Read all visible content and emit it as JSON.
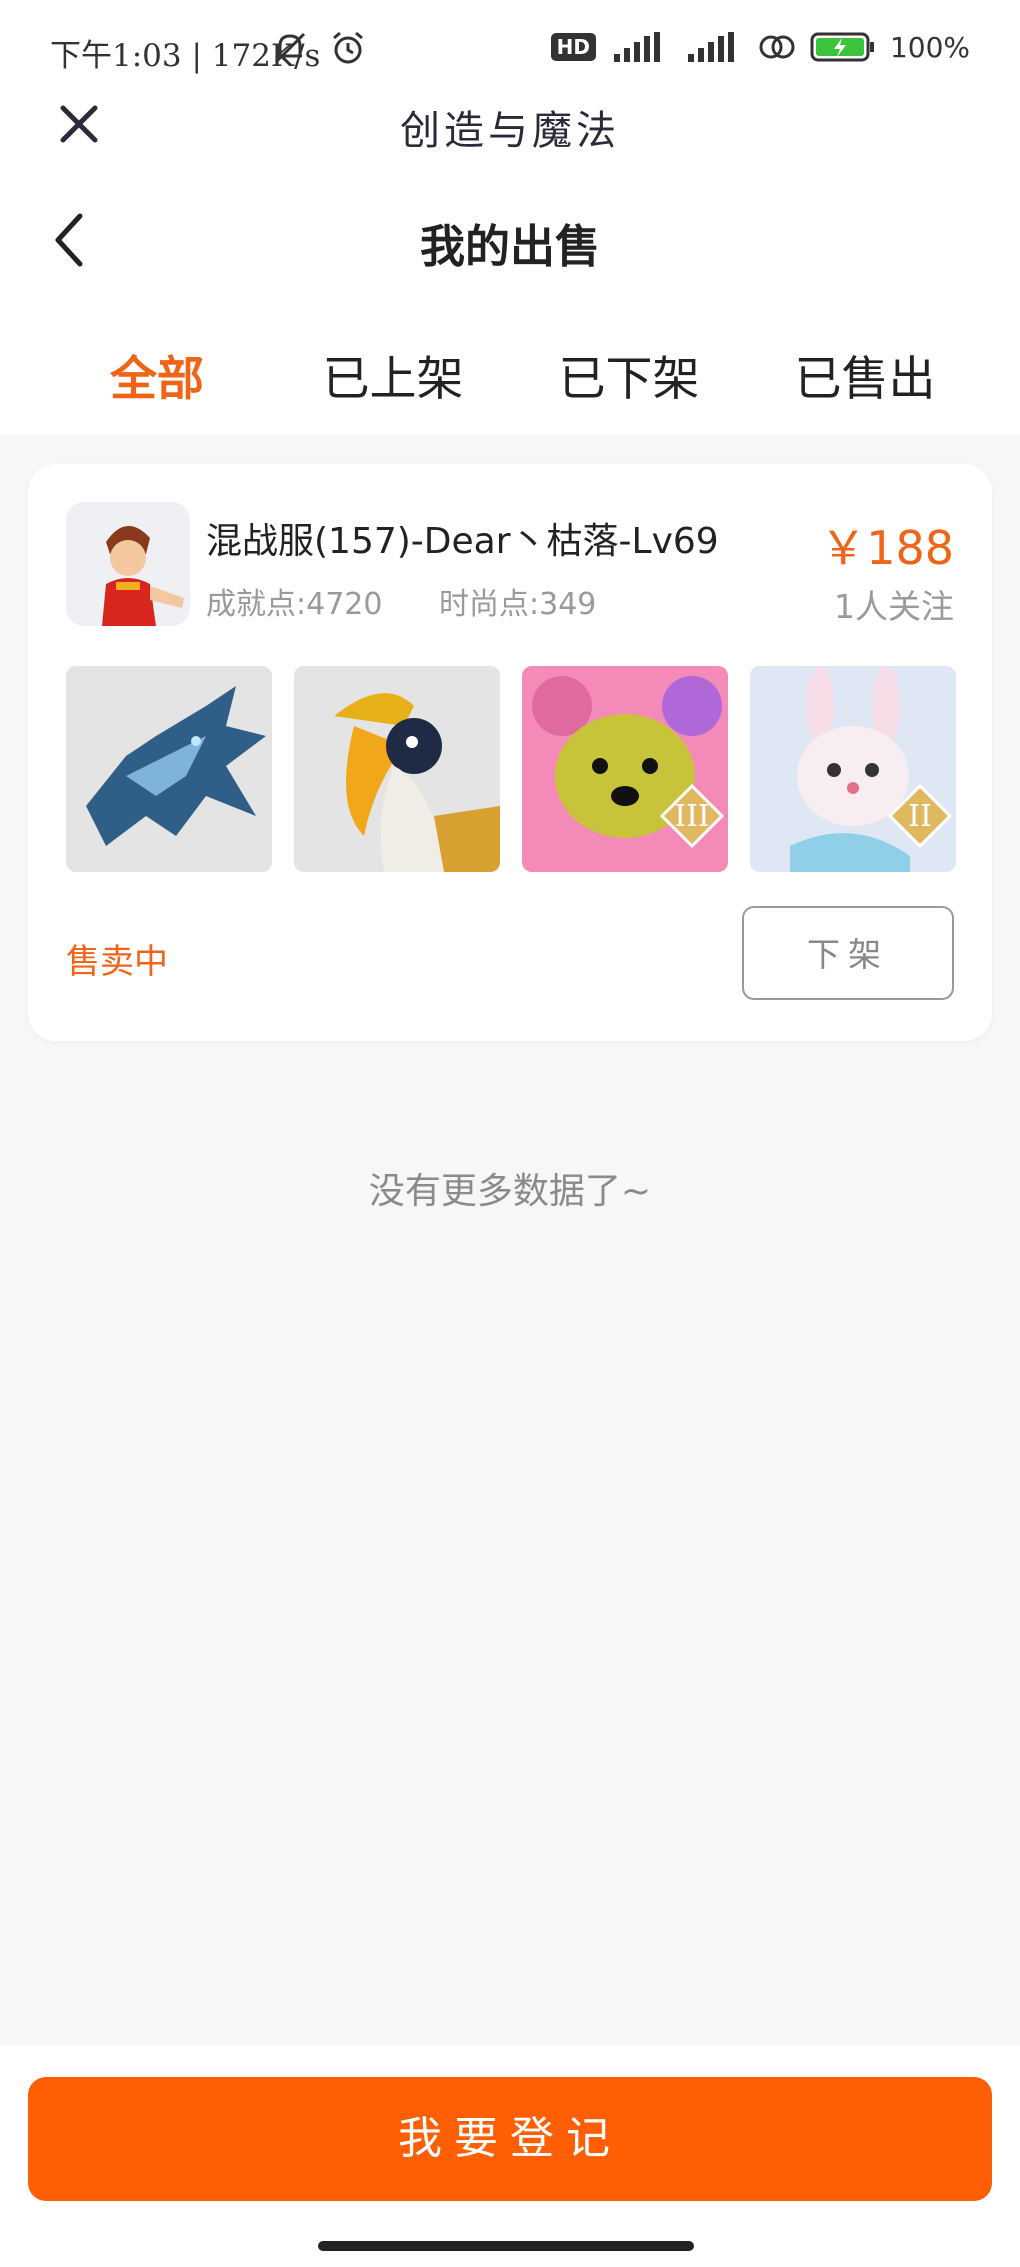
{
  "status_bar": {
    "time": "下午1:03 | 172K/s",
    "hd": "HD",
    "battery": "100%"
  },
  "webview": {
    "app_title": "创造与魔法"
  },
  "header": {
    "title": "我的出售"
  },
  "tabs": [
    {
      "label": "全部",
      "active": true
    },
    {
      "label": "已上架",
      "active": false
    },
    {
      "label": "已下架",
      "active": false
    },
    {
      "label": "已售出",
      "active": false
    }
  ],
  "listing": {
    "title": "混战服(157)-Dear丶枯落-Lv69",
    "achievement": "成就点:4720",
    "fashion": "时尚点:349",
    "price": "￥188",
    "followers": "1人关注",
    "status": "售卖中",
    "delist_label": "下架",
    "thumbnails": [
      {
        "icon": "blue-dragon-icon"
      },
      {
        "icon": "hornbill-bird-icon"
      },
      {
        "icon": "pink-bear-icon",
        "rank": "III"
      },
      {
        "icon": "white-rabbit-icon",
        "rank": "II"
      }
    ]
  },
  "footer_note": "没有更多数据了~",
  "bottom": {
    "register_label": "我要登记"
  },
  "colors": {
    "accent": "#f06418",
    "primary_button": "#ff5e05"
  }
}
